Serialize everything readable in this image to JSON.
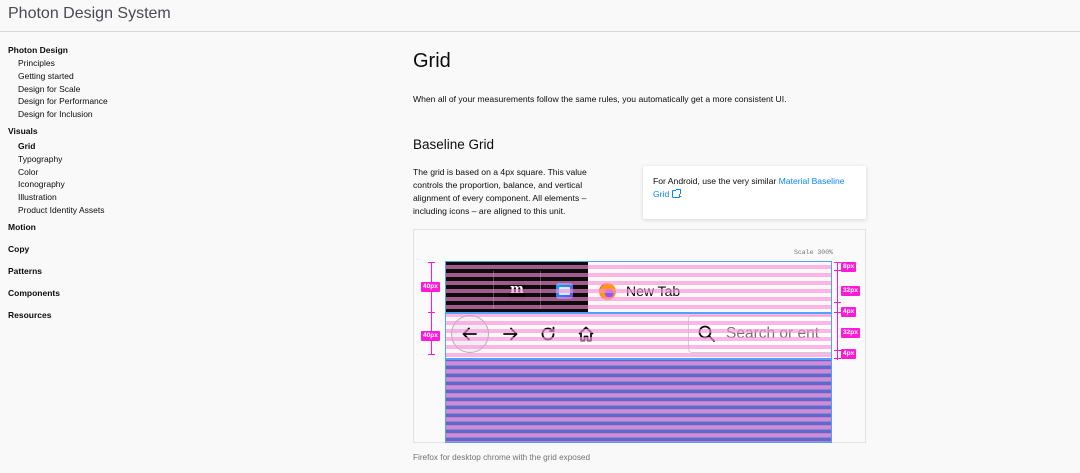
{
  "site": {
    "title": "Photon Design System"
  },
  "sidebar": {
    "sections": [
      {
        "title": "Photon Design",
        "items": [
          "Principles",
          "Getting started",
          "Design for Scale",
          "Design for Performance",
          "Design for Inclusion"
        ]
      },
      {
        "title": "Visuals",
        "items": [
          "Grid",
          "Typography",
          "Color",
          "Iconography",
          "Illustration",
          "Product Identity Assets"
        ],
        "active": "Grid"
      },
      {
        "title": "Motion",
        "items": []
      },
      {
        "title": "Copy",
        "items": []
      },
      {
        "title": "Patterns",
        "items": []
      },
      {
        "title": "Components",
        "items": []
      },
      {
        "title": "Resources",
        "items": []
      }
    ]
  },
  "main": {
    "title": "Grid",
    "intro": "When all of your measurements follow the same rules, you automatically get a more consistent UI.",
    "section_title": "Baseline Grid",
    "body": "The grid is based on a 4px square. This value controls the proportion, balance, and vertical alignment of every component. All elements – including icons – are aligned to this unit.",
    "note": {
      "prefix": "For Android, use the very similar ",
      "link_text": "Material Baseline Grid",
      "suffix": "."
    },
    "figure": {
      "scale_label": "Scale 300%",
      "tab_label": "New Tab",
      "search_placeholder": "Search or ent",
      "left_tags": [
        "40px",
        "40px"
      ],
      "right_tags": [
        "8px",
        "32px",
        "4px",
        "32px",
        "4px"
      ],
      "caption": "Firefox for desktop chrome with the grid exposed"
    }
  },
  "colors": {
    "accent_link": "#0a84ff",
    "measure": "#ff1ad9",
    "grid_frame": "#4da3ff"
  }
}
